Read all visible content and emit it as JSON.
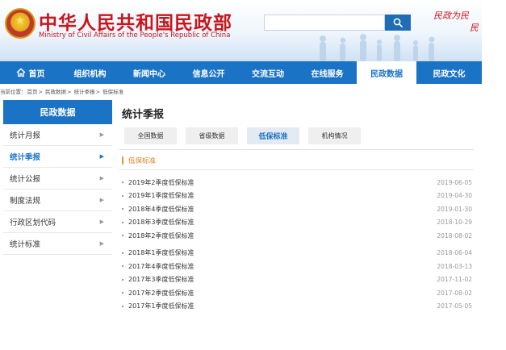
{
  "header": {
    "title": "中华人民共和国民政部",
    "subtitle": "Ministry of Civil Affairs of the People's Republic of China",
    "search_placeholder": "",
    "slogan_line1": "民政为民",
    "slogan_line2": "民",
    "colors": {
      "brand_red": "#c8161d",
      "brand_blue": "#1b73c5"
    }
  },
  "nav": {
    "items": [
      {
        "label": "首页",
        "icon": "home-icon"
      },
      {
        "label": "组织机构"
      },
      {
        "label": "新闻中心"
      },
      {
        "label": "信息公开"
      },
      {
        "label": "交流互动"
      },
      {
        "label": "在线服务"
      },
      {
        "label": "民政数据",
        "active": true
      },
      {
        "label": "民政文化"
      }
    ]
  },
  "breadcrumb": {
    "prefix": "当前位置：",
    "items": [
      "首页",
      "民政数据",
      "统计季报",
      "低保标准"
    ],
    "separator": ">"
  },
  "sidebar": {
    "heading": "民政数据",
    "items": [
      {
        "label": "统计月报"
      },
      {
        "label": "统计季报",
        "active": true
      },
      {
        "label": "统计公报"
      },
      {
        "label": "制度法规"
      },
      {
        "label": "行政区划代码"
      },
      {
        "label": "统计标准"
      }
    ]
  },
  "main": {
    "title": "统计季报",
    "tabs": [
      {
        "label": "全国数据"
      },
      {
        "label": "省级数据"
      },
      {
        "label": "低保标准",
        "active": true
      },
      {
        "label": "机构情况"
      }
    ],
    "section_title": "低保标准",
    "rows": [
      {
        "title": "2019年2季度低保标准",
        "date": "2019-06-05"
      },
      {
        "title": "2019年1季度低保标准",
        "date": "2019-04-30"
      },
      {
        "title": "2018年4季度低保标准",
        "date": "2019-01-30"
      },
      {
        "title": "2018年3季度低保标准",
        "date": "2018-10-29"
      },
      {
        "title": "2018年2季度低保标准",
        "date": "2018-08-02"
      },
      {
        "title": "2018年1季度低保标准",
        "date": "2018-06-04"
      },
      {
        "title": "2017年4季度低保标准",
        "date": "2018-03-13"
      },
      {
        "title": "2017年3季度低保标准",
        "date": "2017-11-02"
      },
      {
        "title": "2017年2季度低保标准",
        "date": "2017-08-02"
      },
      {
        "title": "2017年1季度低保标准",
        "date": "2017-05-05"
      }
    ]
  }
}
